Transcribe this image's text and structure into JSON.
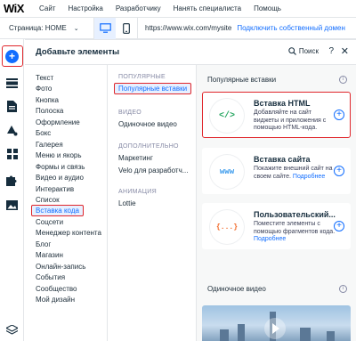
{
  "topbar": {
    "logo": "WiX",
    "menu": [
      "Сайт",
      "Настройка",
      "Разработчику",
      "Нанять специалиста",
      "Помощь"
    ]
  },
  "secondbar": {
    "page_label": "Страница: HOME",
    "url": "https://www.wix.com/mysite",
    "connect_domain": "Подключить собственный домен"
  },
  "panel": {
    "title": "Добавьте элементы",
    "search_label": "Поиск",
    "help": "?",
    "close": "✕"
  },
  "categories": [
    "Текст",
    "Фото",
    "Кнопка",
    "Полоска",
    "Оформление",
    "Бокс",
    "Галерея",
    "Меню и якорь",
    "Формы и связь",
    "Видео и аудио",
    "Интерактив",
    "Список",
    "Вставка кода",
    "Соцсети",
    "Менеджер контента",
    "Блог",
    "Магазин",
    "Онлайн-запись",
    "События",
    "Сообщество",
    "Мой дизайн"
  ],
  "selected_category_index": 12,
  "subcategories": {
    "popular_head": "ПОПУЛЯРНЫЕ",
    "popular_item": "Популярные вставки",
    "video_head": "ВИДЕО",
    "video_item": "Одиночное видео",
    "extra_head": "ДОПОЛНИТЕЛЬНО",
    "extra_item1": "Маркетинг",
    "extra_item2": "Velo для разработч...",
    "anim_head": "АНИМАЦИЯ",
    "anim_item": "Lottie"
  },
  "content": {
    "popular_head": "Популярные вставки",
    "video_head": "Одиночное видео",
    "cards": [
      {
        "icon_text": "</>",
        "title": "Вставка HTML",
        "desc": "Добавляйте на сайт виджеты и приложения с помощью HTML-кода.",
        "link": ""
      },
      {
        "icon_text": "www",
        "title": "Вставка сайта",
        "desc": "Покажите внешний сайт на своем сайте.",
        "link": "Подробнее"
      },
      {
        "icon_text": "{...}",
        "title": "Пользовательский...",
        "desc": "Поместите элементы с помощью фрагментов кода.",
        "link": "Подробнее"
      }
    ]
  },
  "colors": {
    "accent": "#116dff",
    "highlight_border": "#e0262b",
    "code_green": "#25a55f",
    "www_blue": "#3899ec",
    "custom_orange": "#f26522"
  }
}
